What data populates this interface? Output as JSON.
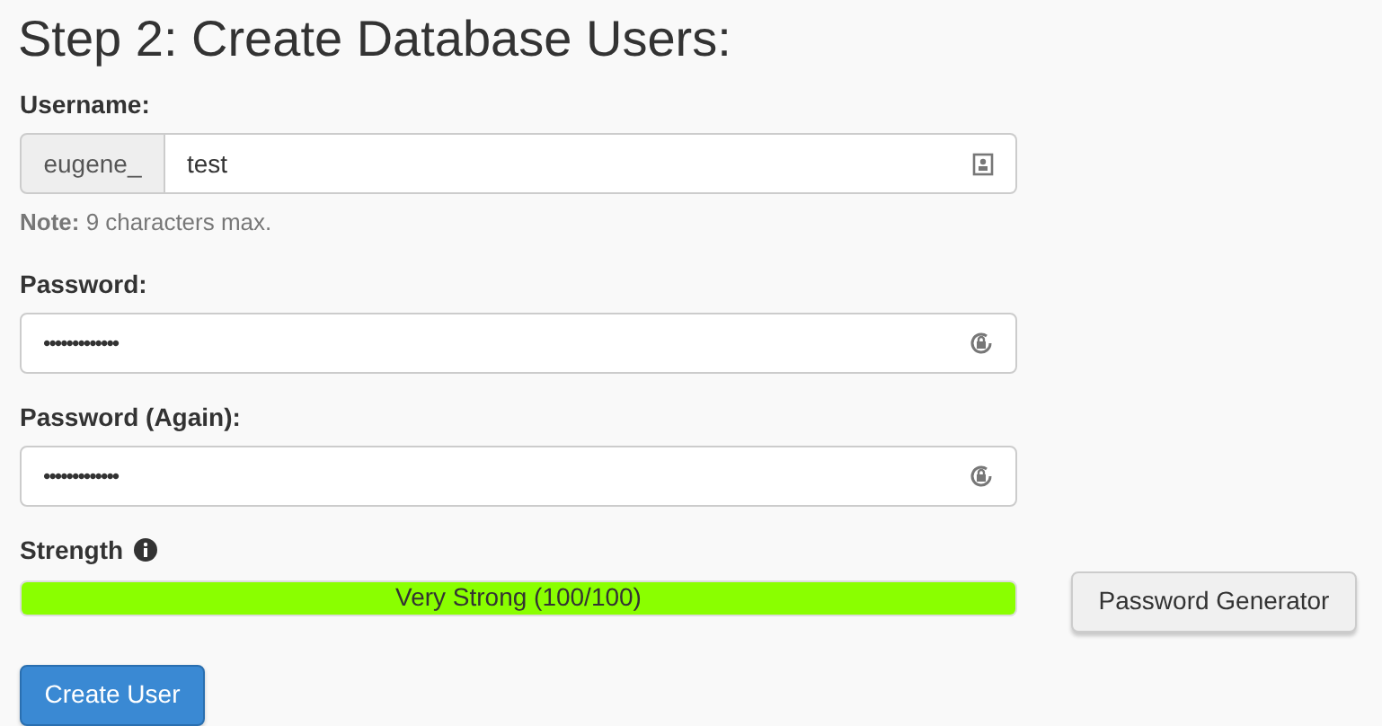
{
  "title": "Step 2: Create Database Users:",
  "username": {
    "label": "Username:",
    "prefix": "eugene_",
    "value": "test",
    "note": "**Note:** 9 characters max."
  },
  "password": {
    "label": "Password:",
    "value": "•••••••••••••"
  },
  "password_again": {
    "label": "Password (Again):",
    "value": "•••••••••••••"
  },
  "strength": {
    "label": "Strength",
    "level": 1,
    "reading": "Very Strong (100/100)"
  },
  "buttons": {
    "generator": "Password Generator",
    "create": "Create User"
  }
}
